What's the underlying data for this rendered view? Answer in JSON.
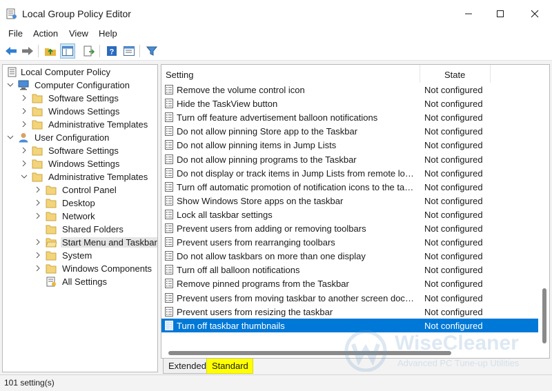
{
  "window": {
    "title": "Local Group Policy Editor"
  },
  "menu": [
    "File",
    "Action",
    "View",
    "Help"
  ],
  "toolbar": {
    "buttons": [
      "back-icon",
      "forward-icon",
      "up-folder-icon",
      "show-hide-tree-icon",
      "export-list-icon",
      "help-icon",
      "properties-icon",
      "filter-icon"
    ]
  },
  "tree": [
    {
      "label": "Local Computer Policy",
      "icon": "policy-root-icon"
    },
    {
      "label": "Computer Configuration",
      "icon": "computer-icon"
    },
    {
      "label": "Software Settings",
      "icon": "folder-icon"
    },
    {
      "label": "Windows Settings",
      "icon": "folder-icon"
    },
    {
      "label": "Administrative Templates",
      "icon": "folder-icon"
    },
    {
      "label": "User Configuration",
      "icon": "user-icon"
    },
    {
      "label": "Software Settings",
      "icon": "folder-icon"
    },
    {
      "label": "Windows Settings",
      "icon": "folder-icon"
    },
    {
      "label": "Administrative Templates",
      "icon": "folder-icon"
    },
    {
      "label": "Control Panel",
      "icon": "folder-icon"
    },
    {
      "label": "Desktop",
      "icon": "folder-icon"
    },
    {
      "label": "Network",
      "icon": "folder-icon"
    },
    {
      "label": "Shared Folders",
      "icon": "folder-icon"
    },
    {
      "label": "Start Menu and Taskbar",
      "icon": "folder-icon",
      "selected": true
    },
    {
      "label": "System",
      "icon": "folder-icon"
    },
    {
      "label": "Windows Components",
      "icon": "folder-icon"
    },
    {
      "label": "All Settings",
      "icon": "all-settings-icon"
    }
  ],
  "list": {
    "columns": {
      "setting": "Setting",
      "state": "State"
    },
    "rows": [
      {
        "name": "Remove the volume control icon",
        "state": "Not configured"
      },
      {
        "name": "Hide the TaskView button",
        "state": "Not configured"
      },
      {
        "name": "Turn off feature advertisement balloon notifications",
        "state": "Not configured"
      },
      {
        "name": "Do not allow pinning Store app to the Taskbar",
        "state": "Not configured"
      },
      {
        "name": "Do not allow pinning items in Jump Lists",
        "state": "Not configured"
      },
      {
        "name": "Do not allow pinning programs to the Taskbar",
        "state": "Not configured"
      },
      {
        "name": "Do not display or track items in Jump Lists from remote locati...",
        "state": "Not configured"
      },
      {
        "name": "Turn off automatic promotion of notification icons to the tas...",
        "state": "Not configured"
      },
      {
        "name": "Show Windows Store apps on the taskbar",
        "state": "Not configured"
      },
      {
        "name": "Lock all taskbar settings",
        "state": "Not configured"
      },
      {
        "name": "Prevent users from adding or removing toolbars",
        "state": "Not configured"
      },
      {
        "name": "Prevent users from rearranging toolbars",
        "state": "Not configured"
      },
      {
        "name": "Do not allow taskbars on more than one display",
        "state": "Not configured"
      },
      {
        "name": "Turn off all balloon notifications",
        "state": "Not configured"
      },
      {
        "name": "Remove pinned programs from the Taskbar",
        "state": "Not configured"
      },
      {
        "name": "Prevent users from moving taskbar to another screen dock lo...",
        "state": "Not configured"
      },
      {
        "name": "Prevent users from resizing the taskbar",
        "state": "Not configured"
      },
      {
        "name": "Turn off taskbar thumbnails",
        "state": "Not configured",
        "selected": true
      }
    ]
  },
  "tabs": {
    "extended": "Extended",
    "standard": "Standard"
  },
  "watermark": {
    "brand": "WiseCleaner",
    "tagline": "Advanced PC Tune-up Utilities"
  },
  "status": {
    "count_text": "101 setting(s)"
  },
  "colors": {
    "selection": "#0078d7",
    "highlight": "#ffff00"
  }
}
